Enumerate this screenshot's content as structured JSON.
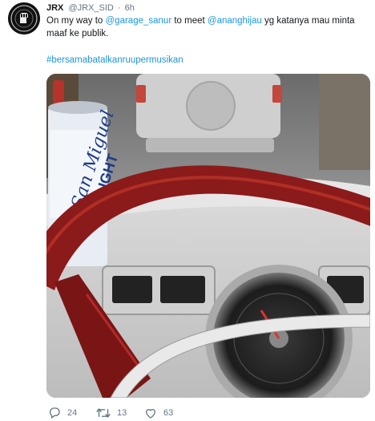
{
  "tweet": {
    "display_name": "JRX",
    "handle": "@JRX_SID",
    "separator": "·",
    "time": "6h",
    "text_parts": {
      "p1": "On my way to ",
      "m1": "@garage_sanur",
      "p2": " to meet ",
      "m2": "@ananghijau",
      "p3": " yg katanya mau minta maaf ke publik."
    },
    "hashtag": "#bersamabatalkanruupermusikan"
  },
  "media": {
    "can_label_brand": "San Miguel",
    "can_label_variant": "LIGHT"
  },
  "actions": {
    "reply_count": "24",
    "retweet_count": "13",
    "like_count": "63"
  },
  "colors": {
    "link": "#1b95e0",
    "muted": "#657786",
    "steering_wheel": "#8b1a1a"
  },
  "icons": [
    "avatar-logo-icon",
    "reply-icon",
    "retweet-icon",
    "like-icon"
  ]
}
